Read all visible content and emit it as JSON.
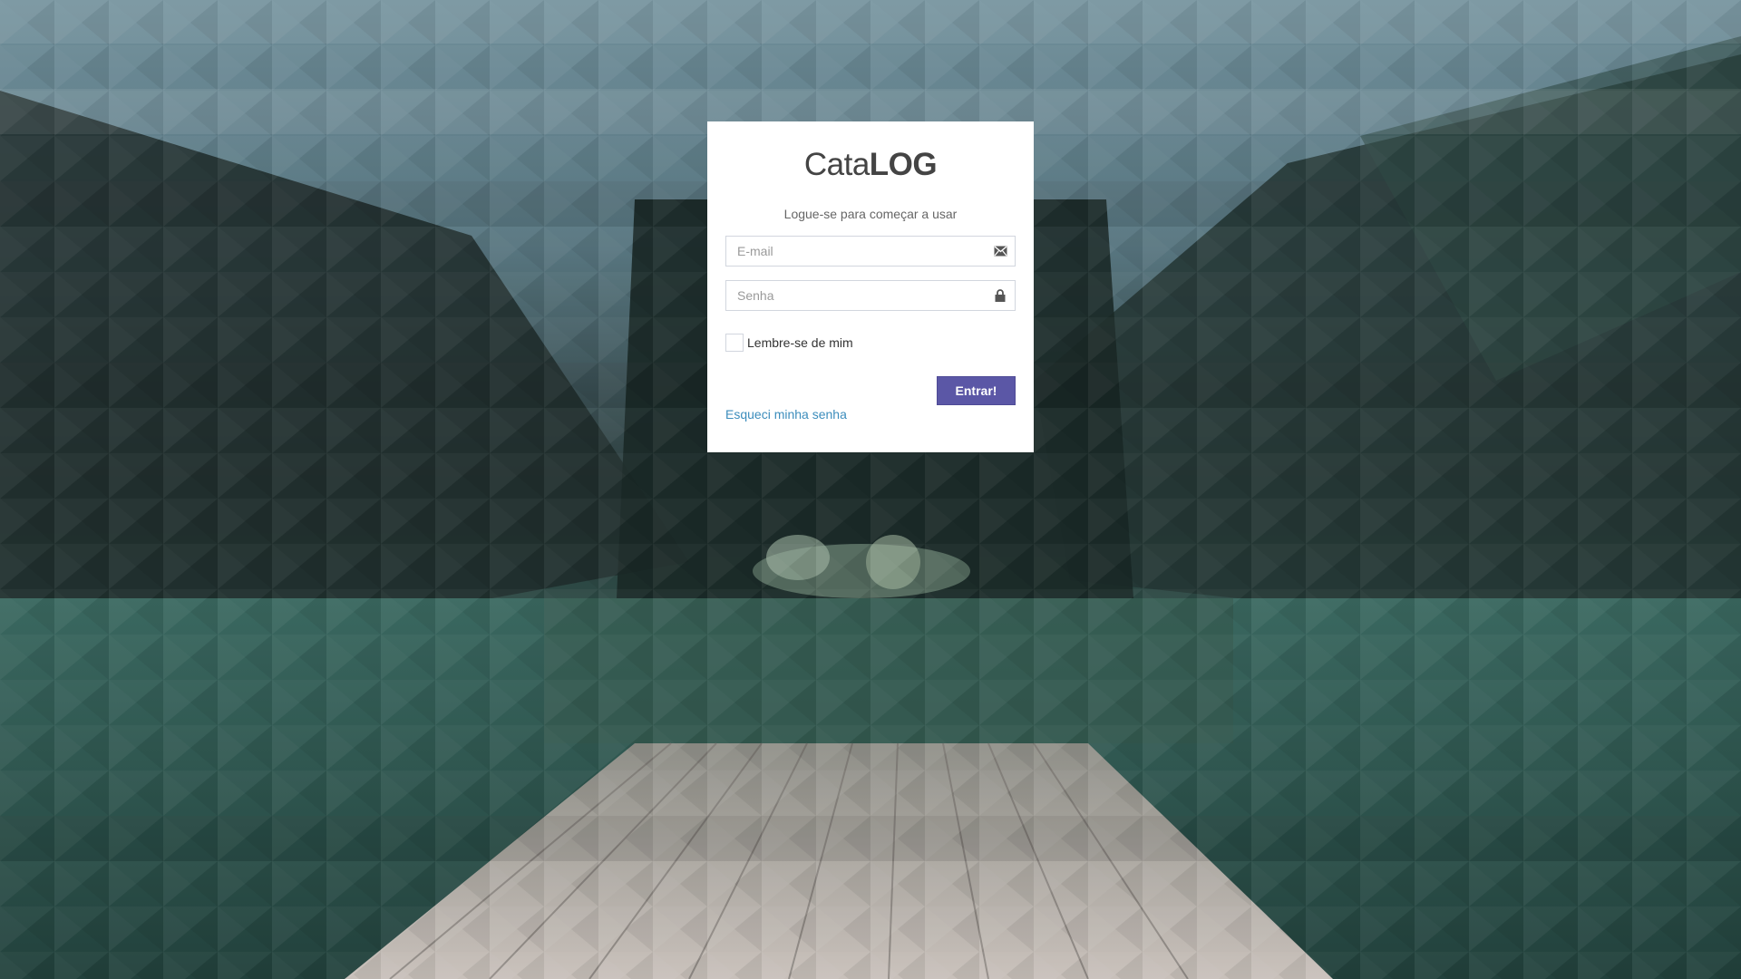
{
  "logo": {
    "part_light": "Cata",
    "part_bold": "LOG"
  },
  "subtitle": "Logue-se para começar a usar",
  "email": {
    "placeholder": "E-mail",
    "value": "",
    "icon": "envelope-icon"
  },
  "password": {
    "placeholder": "Senha",
    "value": "",
    "icon": "lock-icon"
  },
  "remember": {
    "label": "Lembre-se de mim",
    "checked": false
  },
  "submit_label": "Entrar!",
  "forgot_label": "Esqueci minha senha",
  "colors": {
    "primary_button": "#5b57a6",
    "link": "#3c8dbc",
    "box_background": "#ffffff"
  }
}
